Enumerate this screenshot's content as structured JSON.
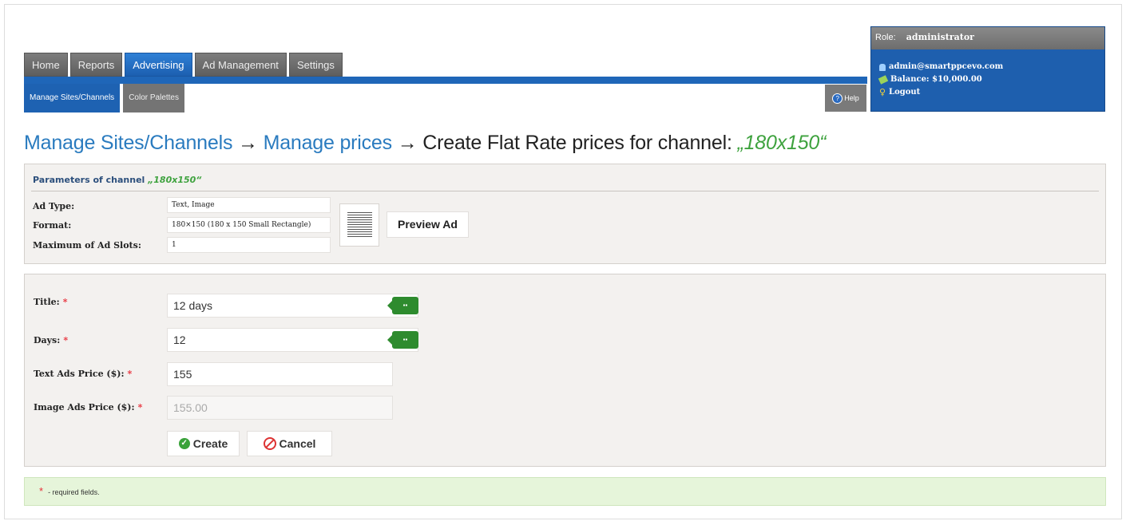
{
  "nav": {
    "tabs": [
      {
        "label": "Home"
      },
      {
        "label": "Reports"
      },
      {
        "label": "Advertising"
      },
      {
        "label": "Ad Management"
      },
      {
        "label": "Settings"
      }
    ],
    "active_tab": "Advertising",
    "subtabs": [
      {
        "label": "Manage Sites/Channels"
      },
      {
        "label": "Color Palettes"
      }
    ],
    "help_label": "Help"
  },
  "account": {
    "role_label": "Role:",
    "role_value": "administrator",
    "email": "admin@smartppcevo.com",
    "balance": "Balance: $10,000.00",
    "logout": "Logout"
  },
  "heading": {
    "crumb1": "Manage Sites/Channels",
    "arrow": "→",
    "crumb2": "Manage prices",
    "current": "Create Flat Rate prices for channel:",
    "channel": "„180x150“"
  },
  "params": {
    "title": "Parameters of channel",
    "channel": "„180x150“",
    "ad_type_label": "Ad Type:",
    "ad_type_value": "Text, Image",
    "format_label": "Format:",
    "format_value": "180×150 (180 x 150 Small Rectangle)",
    "slots_label": "Maximum of Ad Slots:",
    "slots_value": "1",
    "preview_button": "Preview Ad"
  },
  "form": {
    "title_label": "Title:",
    "title_value": "12 days",
    "days_label": "Days:",
    "days_value": "12",
    "text_price_label": "Text Ads Price ($):",
    "text_price_value": "155",
    "image_price_label": "Image Ads Price ($):",
    "image_price_value": "155.00",
    "required_mark": "*",
    "create_button": "Create",
    "cancel_button": "Cancel"
  },
  "footer": {
    "required_note": "- required fields."
  },
  "colors": {
    "nav_blue": "#1f66b8",
    "link_blue": "#2a7bbf",
    "channel_green": "#3ea23e",
    "required_red": "#e8303a",
    "note_bg": "#e6f5da"
  }
}
